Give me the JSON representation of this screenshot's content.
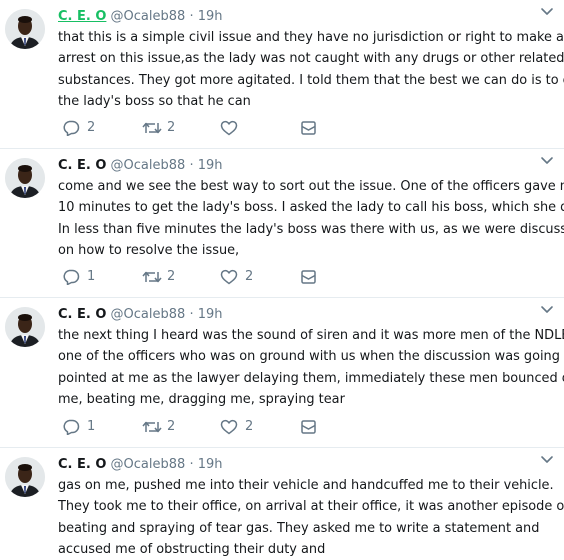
{
  "tweets": [
    {
      "name": "C. E. O",
      "handle": "@Ocaleb88",
      "dot": "·",
      "time": "19h",
      "lines": [
        "that this is a simple civil issue and they have no jurisdiction or right to make any",
        "arrest on this issue,as the lady was not caught with any drugs or other related",
        "substances. They got more agitated. I told them that the best we can do is to call",
        "the lady's boss so that he can"
      ],
      "replies": "2",
      "retweets": "2",
      "likes": ""
    },
    {
      "name": "C. E. O",
      "handle": "@Ocaleb88",
      "dot": "·",
      "time": "19h",
      "lines": [
        "come and we see the best way to sort out the issue. One of the officers  gave me",
        "10 minutes to get the lady's boss. I asked the lady to call his boss, which she did.",
        "In less than five minutes the lady's boss was there with us, as we were discussing",
        "on how to resolve the issue,"
      ],
      "replies": "1",
      "retweets": "2",
      "likes": "2"
    },
    {
      "name": "C. E. O",
      "handle": "@Ocaleb88",
      "dot": "·",
      "time": "19h",
      "lines": [
        "the next thing I heard was the sound of siren and it was more men of the NDLEA,",
        "one of the officers who was on ground with us when the discussion was going on",
        "pointed at me as the lawyer delaying them, immediately these men bounced on",
        "me, beating me, dragging me, spraying tear"
      ],
      "replies": "1",
      "retweets": "2",
      "likes": "2"
    },
    {
      "name": "C. E. O",
      "handle": "@Ocaleb88",
      "dot": "·",
      "time": "19h",
      "lines": [
        "gas on me, pushed me into their vehicle and handcuffed me to their vehicle.",
        "They took me to their office, on arrival at their office, it was another episode of",
        "beating and spraying of tear gas. They asked me to write a statement and",
        "accused me of obstructing their duty and"
      ]
    }
  ],
  "icons": {
    "reply": "speech-bubble-icon",
    "retweet": "retweet-icon",
    "like": "heart-icon",
    "dm": "envelope-icon",
    "more": "chevron-down-icon"
  },
  "colors": {
    "text": "#14171a",
    "secondary": "#657786",
    "highlight_name": "#17bf63",
    "divider": "#e6ecf0"
  }
}
